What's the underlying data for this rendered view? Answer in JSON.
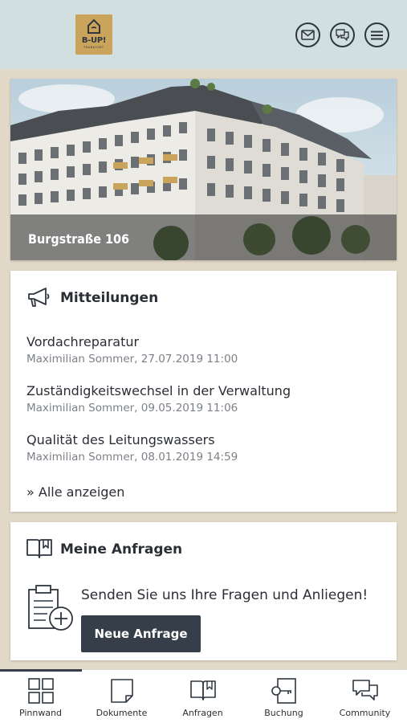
{
  "header": {
    "logo_text": "B-UP!",
    "logo_subtext": "FRANKFURT",
    "icons": [
      "mail-icon",
      "chat-icon",
      "menu-icon"
    ]
  },
  "hero": {
    "title": "Burgstraße 106"
  },
  "messages": {
    "title": "Mitteilungen",
    "items": [
      {
        "title": "Vordachreparatur",
        "meta": "Maximilian Sommer, 27.07.2019 11:00"
      },
      {
        "title": "Zuständigkeitswechsel in der Verwaltung",
        "meta": "Maximilian Sommer, 09.05.2019 11:06"
      },
      {
        "title": "Qualität des Leitungswassers",
        "meta": "Maximilian Sommer, 08.01.2019 14:59"
      }
    ],
    "show_all": "» Alle anzeigen"
  },
  "requests": {
    "title": "Meine Anfragen",
    "prompt": "Senden Sie uns Ihre Fragen und Anliegen!",
    "button": "Neue Anfrage"
  },
  "nav": {
    "items": [
      {
        "label": "Pinnwand",
        "icon": "grid-icon",
        "active": true
      },
      {
        "label": "Dokumente",
        "icon": "document-icon",
        "active": false
      },
      {
        "label": "Anfragen",
        "icon": "book-icon",
        "active": false
      },
      {
        "label": "Buchung",
        "icon": "key-icon",
        "active": false
      },
      {
        "label": "Community",
        "icon": "community-chat-icon",
        "active": false
      }
    ]
  },
  "colors": {
    "header_bg": "#d2dfe0",
    "page_bg": "#e3d9c8",
    "logo_gold": "#c9a45a",
    "button_bg": "#363f49"
  }
}
